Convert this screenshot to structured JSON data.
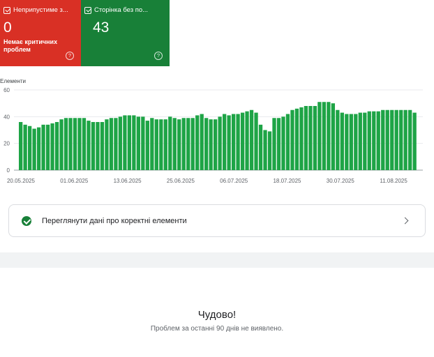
{
  "cards": [
    {
      "title": "Неприпустиме з...",
      "value": "0",
      "subtitle": "Немає критичних проблем",
      "help": "?"
    },
    {
      "title": "Сторінка без по...",
      "value": "43",
      "subtitle": "",
      "help": "?"
    }
  ],
  "colors": {
    "error": "#d93025",
    "valid": "#188038",
    "bar": "#1ea446"
  },
  "chart_data": {
    "type": "bar",
    "ylabel": "Елементи",
    "ylim": [
      0,
      60
    ],
    "yticks": [
      0,
      20,
      40,
      60
    ],
    "xtick_labels": [
      "20.05.2025",
      "01.06.2025",
      "13.06.2025",
      "25.06.2025",
      "06.07.2025",
      "18.07.2025",
      "30.07.2025",
      "11.08.2025"
    ],
    "series": [
      {
        "values": [
          36,
          34,
          33,
          31,
          32,
          34,
          34,
          35,
          36,
          38,
          39,
          39,
          39,
          39,
          39,
          37,
          36,
          36,
          36,
          38,
          39,
          39,
          40,
          41,
          41,
          41,
          40,
          40,
          37,
          39,
          38,
          38,
          38,
          40,
          39,
          38,
          39,
          39,
          39,
          41,
          42,
          39,
          38,
          38,
          40,
          42,
          41,
          42,
          42,
          43,
          44,
          45,
          43,
          34,
          30,
          29,
          39,
          39,
          40,
          42,
          45,
          46,
          47,
          48,
          48,
          48,
          51,
          51,
          51,
          50,
          45,
          43,
          42,
          42,
          42,
          43,
          43,
          44,
          44,
          44,
          45,
          45,
          45,
          45,
          45,
          45,
          45,
          43
        ]
      }
    ],
    "grid": true,
    "legend": "none"
  },
  "link": {
    "label": "Переглянути дані про коректні елементи"
  },
  "status": {
    "title": "Чудово!",
    "subtitle": "Проблем за останні 90 днів не виявлено."
  }
}
